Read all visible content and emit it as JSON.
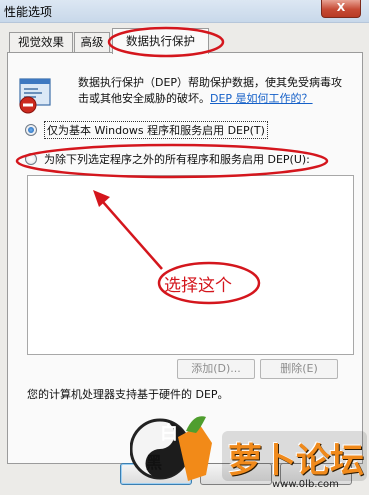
{
  "window": {
    "title": "性能选项",
    "close_glyph": "X"
  },
  "tabs": [
    {
      "label": "视觉效果",
      "active": false
    },
    {
      "label": "高级",
      "active": false
    },
    {
      "label": "数据执行保护",
      "active": true
    }
  ],
  "description": {
    "icon": "dep-shield-window-icon",
    "text": "数据执行保护（DEP）帮助保护数据，使其免受病毒攻击或其他安全威胁的破坏。",
    "link": "DEP 是如何工作的？"
  },
  "options": {
    "option1": {
      "label": "仅为基本 Windows 程序和服务启用 DEP(T)",
      "checked": true
    },
    "option2": {
      "label": "为除下列选定程序之外的所有程序和服务启用 DEP(U):",
      "checked": false
    }
  },
  "exception_list": {
    "items": []
  },
  "buttons": {
    "add": "添加(D)...",
    "remove": "删除(E)"
  },
  "support_text": "您的计算机处理器支持基于硬件的 DEP。",
  "annotation": {
    "callout": "选择这个",
    "color": "#d4161d"
  },
  "watermark": {
    "seal_top": "白",
    "seal_bottom": "黑",
    "brand": "萝卜论坛",
    "url": "www.0lb.com"
  }
}
